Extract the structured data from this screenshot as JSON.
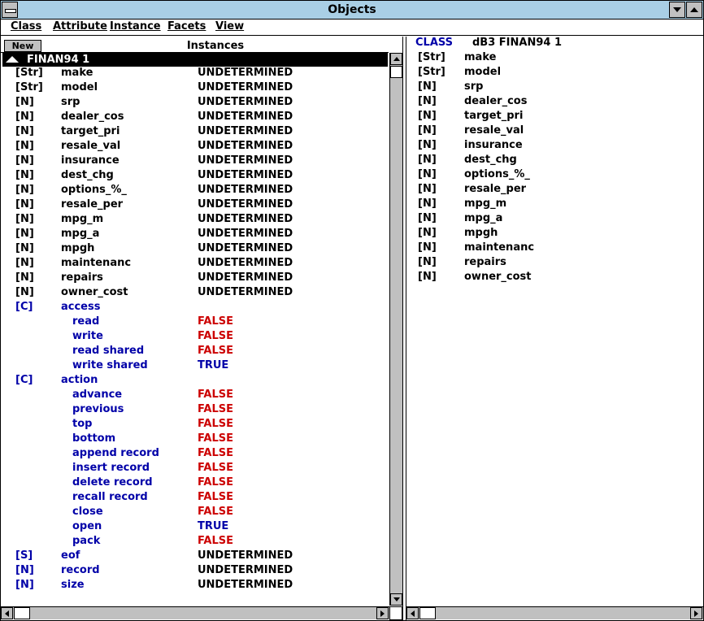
{
  "window": {
    "title": "Objects"
  },
  "menu": [
    "Class",
    "Attribute",
    "Instance",
    "Facets",
    "View"
  ],
  "left": {
    "new_label": "New",
    "header": "Instances",
    "selected": "FINAN94 1",
    "rows": [
      {
        "type": "[Str]",
        "name": "make",
        "value": "UNDETERMINED"
      },
      {
        "type": "[Str]",
        "name": "model",
        "value": "UNDETERMINED"
      },
      {
        "type": "[N]",
        "name": "srp",
        "value": "UNDETERMINED"
      },
      {
        "type": "[N]",
        "name": "dealer_cos",
        "value": "UNDETERMINED"
      },
      {
        "type": "[N]",
        "name": "target_pri",
        "value": "UNDETERMINED"
      },
      {
        "type": "[N]",
        "name": "resale_val",
        "value": "UNDETERMINED"
      },
      {
        "type": "[N]",
        "name": "insurance",
        "value": "UNDETERMINED"
      },
      {
        "type": "[N]",
        "name": "dest_chg",
        "value": "UNDETERMINED"
      },
      {
        "type": "[N]",
        "name": "options_%_",
        "value": "UNDETERMINED"
      },
      {
        "type": "[N]",
        "name": "resale_per",
        "value": "UNDETERMINED"
      },
      {
        "type": "[N]",
        "name": "mpg_m",
        "value": "UNDETERMINED"
      },
      {
        "type": "[N]",
        "name": "mpg_a",
        "value": "UNDETERMINED"
      },
      {
        "type": "[N]",
        "name": "mpgh",
        "value": "UNDETERMINED"
      },
      {
        "type": "[N]",
        "name": "maintenanc",
        "value": "UNDETERMINED"
      },
      {
        "type": "[N]",
        "name": "repairs",
        "value": "UNDETERMINED"
      },
      {
        "type": "[N]",
        "name": "owner_cost",
        "value": "UNDETERMINED"
      },
      {
        "type": "[C]",
        "name": "access",
        "value": "",
        "blue": true
      },
      {
        "type": "",
        "name": "read",
        "value": "FALSE",
        "sub": true,
        "blue": true
      },
      {
        "type": "",
        "name": "write",
        "value": "FALSE",
        "sub": true,
        "blue": true
      },
      {
        "type": "",
        "name": "read shared",
        "value": "FALSE",
        "sub": true,
        "blue": true
      },
      {
        "type": "",
        "name": "write shared",
        "value": "TRUE",
        "sub": true,
        "blue": true
      },
      {
        "type": "[C]",
        "name": "action",
        "value": "",
        "blue": true
      },
      {
        "type": "",
        "name": "advance",
        "value": "FALSE",
        "sub": true,
        "blue": true
      },
      {
        "type": "",
        "name": "previous",
        "value": "FALSE",
        "sub": true,
        "blue": true
      },
      {
        "type": "",
        "name": "top",
        "value": "FALSE",
        "sub": true,
        "blue": true
      },
      {
        "type": "",
        "name": "bottom",
        "value": "FALSE",
        "sub": true,
        "blue": true
      },
      {
        "type": "",
        "name": "append record",
        "value": "FALSE",
        "sub": true,
        "blue": true
      },
      {
        "type": "",
        "name": "insert record",
        "value": "FALSE",
        "sub": true,
        "blue": true
      },
      {
        "type": "",
        "name": "delete record",
        "value": "FALSE",
        "sub": true,
        "blue": true
      },
      {
        "type": "",
        "name": "recall record",
        "value": "FALSE",
        "sub": true,
        "blue": true
      },
      {
        "type": "",
        "name": "close",
        "value": "FALSE",
        "sub": true,
        "blue": true
      },
      {
        "type": "",
        "name": "open",
        "value": "TRUE",
        "sub": true,
        "blue": true
      },
      {
        "type": "",
        "name": "pack",
        "value": "FALSE",
        "sub": true,
        "blue": true
      },
      {
        "type": "[S]",
        "name": "eof",
        "value": "UNDETERMINED",
        "blue": true
      },
      {
        "type": "[N]",
        "name": "record",
        "value": "UNDETERMINED",
        "blue": true
      },
      {
        "type": "[N]",
        "name": "size",
        "value": "UNDETERMINED",
        "blue": true
      }
    ]
  },
  "right": {
    "class_label": "CLASS",
    "class_name": "dB3 FINAN94 1",
    "rows": [
      {
        "type": "[Str]",
        "name": "make"
      },
      {
        "type": "[Str]",
        "name": "model"
      },
      {
        "type": "[N]",
        "name": "srp"
      },
      {
        "type": "[N]",
        "name": "dealer_cos"
      },
      {
        "type": "[N]",
        "name": "target_pri"
      },
      {
        "type": "[N]",
        "name": "resale_val"
      },
      {
        "type": "[N]",
        "name": "insurance"
      },
      {
        "type": "[N]",
        "name": "dest_chg"
      },
      {
        "type": "[N]",
        "name": "options_%_"
      },
      {
        "type": "[N]",
        "name": "resale_per"
      },
      {
        "type": "[N]",
        "name": "mpg_m"
      },
      {
        "type": "[N]",
        "name": "mpg_a"
      },
      {
        "type": "[N]",
        "name": "mpgh"
      },
      {
        "type": "[N]",
        "name": "maintenanc"
      },
      {
        "type": "[N]",
        "name": "repairs"
      },
      {
        "type": "[N]",
        "name": "owner_cost"
      }
    ]
  },
  "colors": {
    "title_bar": "#a9cfe5",
    "blue_text": "#0000a8",
    "red_text": "#cc0000"
  }
}
